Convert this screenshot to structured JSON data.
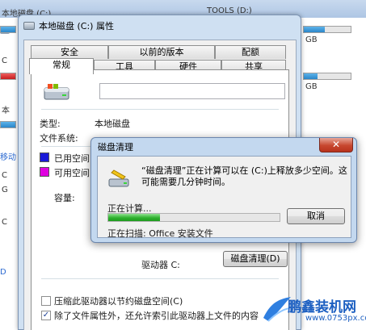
{
  "background": {
    "drive_c_title": "本地磁盘 (C:)",
    "drive_d_title": "TOOLS (D:)",
    "gb_1": "GB",
    "gb_2": "GB",
    "side_1": "C",
    "side_2": "本",
    "side_3": "移动",
    "side_4": "C",
    "side_5": "G",
    "side_6": "C",
    "side_7": "D"
  },
  "properties": {
    "title": "本地磁盘 (C:) 属性",
    "tabs_row1": [
      "安全",
      "以前的版本",
      "配额"
    ],
    "tabs_row2": [
      "常规",
      "工具",
      "硬件",
      "共享"
    ],
    "type_label": "类型:",
    "type_value": "本地磁盘",
    "fs_label": "文件系统:",
    "used_label": "已用空间",
    "free_label": "可用空间",
    "capacity_label": "容量:",
    "drive_label": "驱动器 C:",
    "cleanup_button": "磁盘清理(D)",
    "compress_label": "压缩此驱动器以节约磁盘空间(C)",
    "index_label": "除了文件属性外，还允许索引此驱动器上文件的内容"
  },
  "cleanup": {
    "title": "磁盘清理",
    "close_symbol": "✕",
    "message": "“磁盘清理”正在计算可以在 (C:)上释放多少空间。这可能需要几分钟时间。",
    "calc_label": "正在计算...",
    "cancel_button": "取消",
    "progress": 0.3,
    "scan_label": "正在扫描:  Office 安装文件"
  },
  "watermark": {
    "main": "鹏鑫装机网",
    "sub": "www.0753px.com"
  },
  "colors": {
    "used_swatch": "#1a1ad8",
    "free_swatch": "#e000e0",
    "accent": "#1c5fc1"
  }
}
